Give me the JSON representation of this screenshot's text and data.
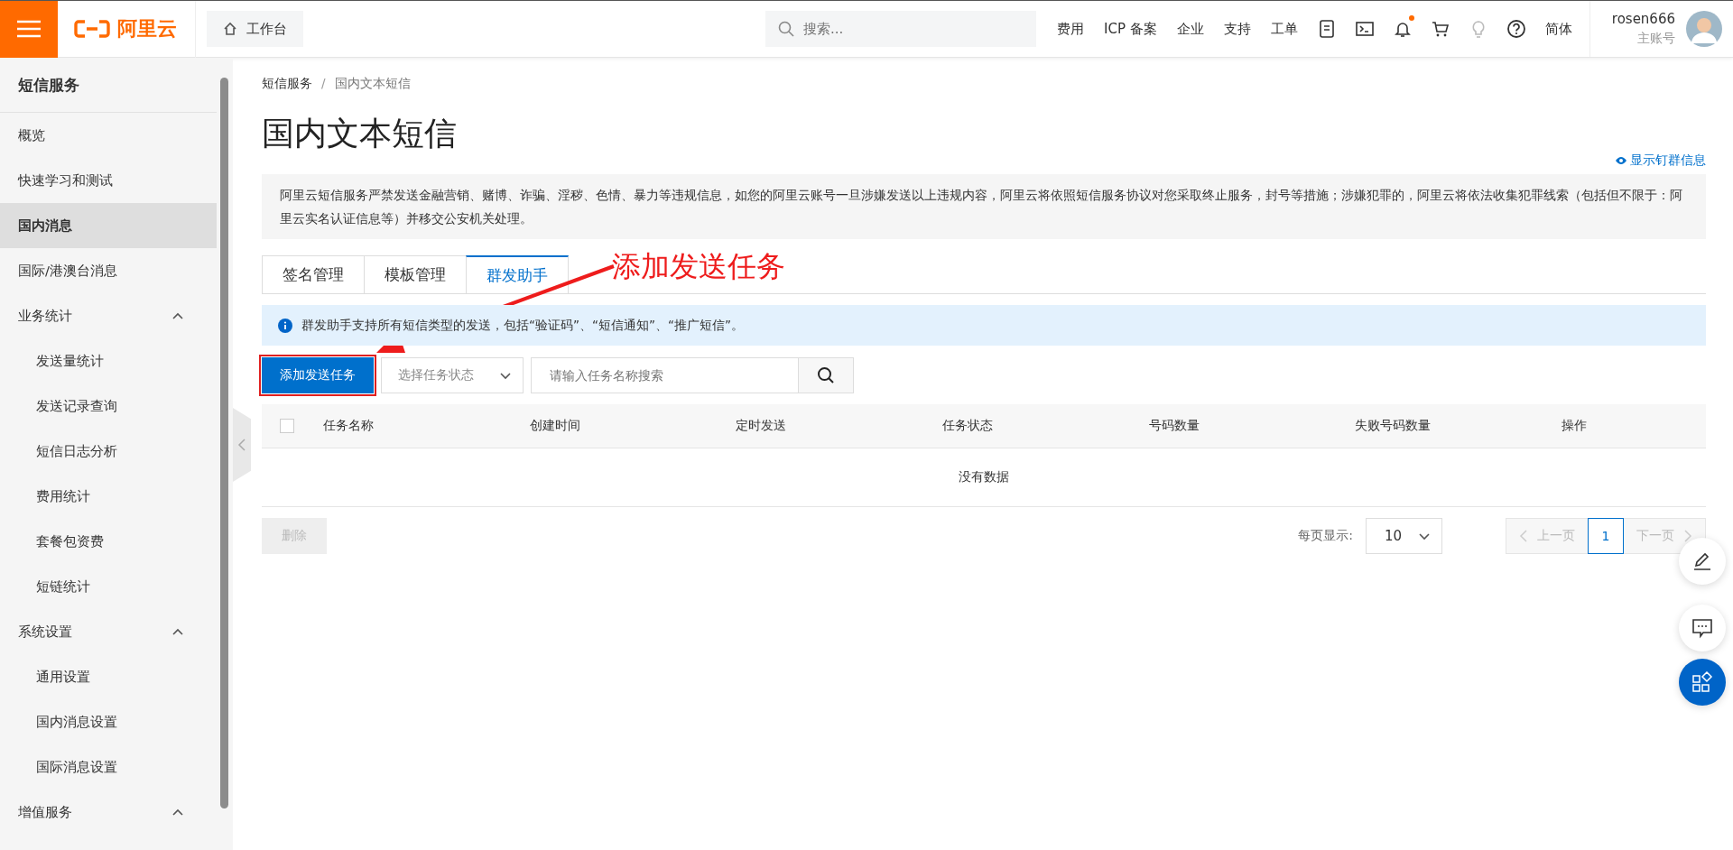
{
  "topbar": {
    "logo": "阿里云",
    "workbench": "工作台",
    "search": {
      "placeholder": "搜索..."
    },
    "nav": [
      "费用",
      "ICP 备案",
      "企业",
      "支持",
      "工单"
    ],
    "bell_badge": true,
    "language": "简体",
    "user": {
      "name": "rosen666",
      "role": "主账号"
    }
  },
  "sidebar": {
    "title": "短信服务",
    "items": [
      {
        "label": "概览",
        "selected": false
      },
      {
        "label": "快速学习和测试",
        "selected": false
      },
      {
        "label": "国内消息",
        "selected": true
      },
      {
        "label": "国际/港澳台消息",
        "selected": false
      },
      {
        "label": "业务统计",
        "selected": false,
        "expanded": true,
        "children": [
          {
            "label": "发送量统计",
            "selected": false
          },
          {
            "label": "发送记录查询",
            "selected": false
          },
          {
            "label": "短信日志分析",
            "selected": false
          },
          {
            "label": "费用统计",
            "selected": false
          },
          {
            "label": "套餐包资费",
            "selected": false
          },
          {
            "label": "短链统计",
            "selected": false
          }
        ]
      },
      {
        "label": "系统设置",
        "selected": false,
        "expanded": true,
        "children": [
          {
            "label": "通用设置",
            "selected": false
          },
          {
            "label": "国内消息设置",
            "selected": false
          },
          {
            "label": "国际消息设置",
            "selected": false
          }
        ]
      },
      {
        "label": "增值服务",
        "selected": false,
        "expanded": true
      }
    ]
  },
  "breadcrumb": [
    "短信服务",
    "国内文本短信"
  ],
  "breadcrumb_separator": "/",
  "title": "国内文本短信",
  "ding_link": "显示钉群信息",
  "notice": "阿里云短信服务严禁发送金融营销、赌博、诈骗、淫秽、色情、暴力等违规信息，如您的阿里云账号一旦涉嫌发送以上违规内容，阿里云将依照短信服务协议对您采取终止服务，封号等措施；涉嫌犯罪的，阿里云将依法收集犯罪线索（包括但不限于：阿里云实名认证信息等）并移交公安机关处理。",
  "tabs": [
    {
      "label": "签名管理",
      "selected": false
    },
    {
      "label": "模板管理",
      "selected": false
    },
    {
      "label": "群发助手",
      "selected": true
    }
  ],
  "info": "群发助手支持所有短信类型的发送，包括“验证码”、“短信通知”、“推广短信”。",
  "toolbar": {
    "add_button": "添加发送任务",
    "status_select": {
      "placeholder": "选择任务状态"
    },
    "search": {
      "placeholder": "请输入任务名称搜索"
    }
  },
  "table": {
    "select_all": false,
    "columns": [
      "任务名称",
      "创建时间",
      "定时发送",
      "任务状态",
      "号码数量",
      "失败号码数量",
      "操作"
    ],
    "empty": "没有数据"
  },
  "delete_button": {
    "label": "删除",
    "disabled": true
  },
  "pagination": {
    "page_size_label": "每页显示:",
    "page_size": "10",
    "prev": {
      "label": "上一页",
      "disabled": true
    },
    "pages": [
      {
        "label": "1",
        "selected": true
      }
    ],
    "next": {
      "label": "下一页",
      "disabled": true
    }
  },
  "annotation": {
    "text": "添加发送任务"
  }
}
